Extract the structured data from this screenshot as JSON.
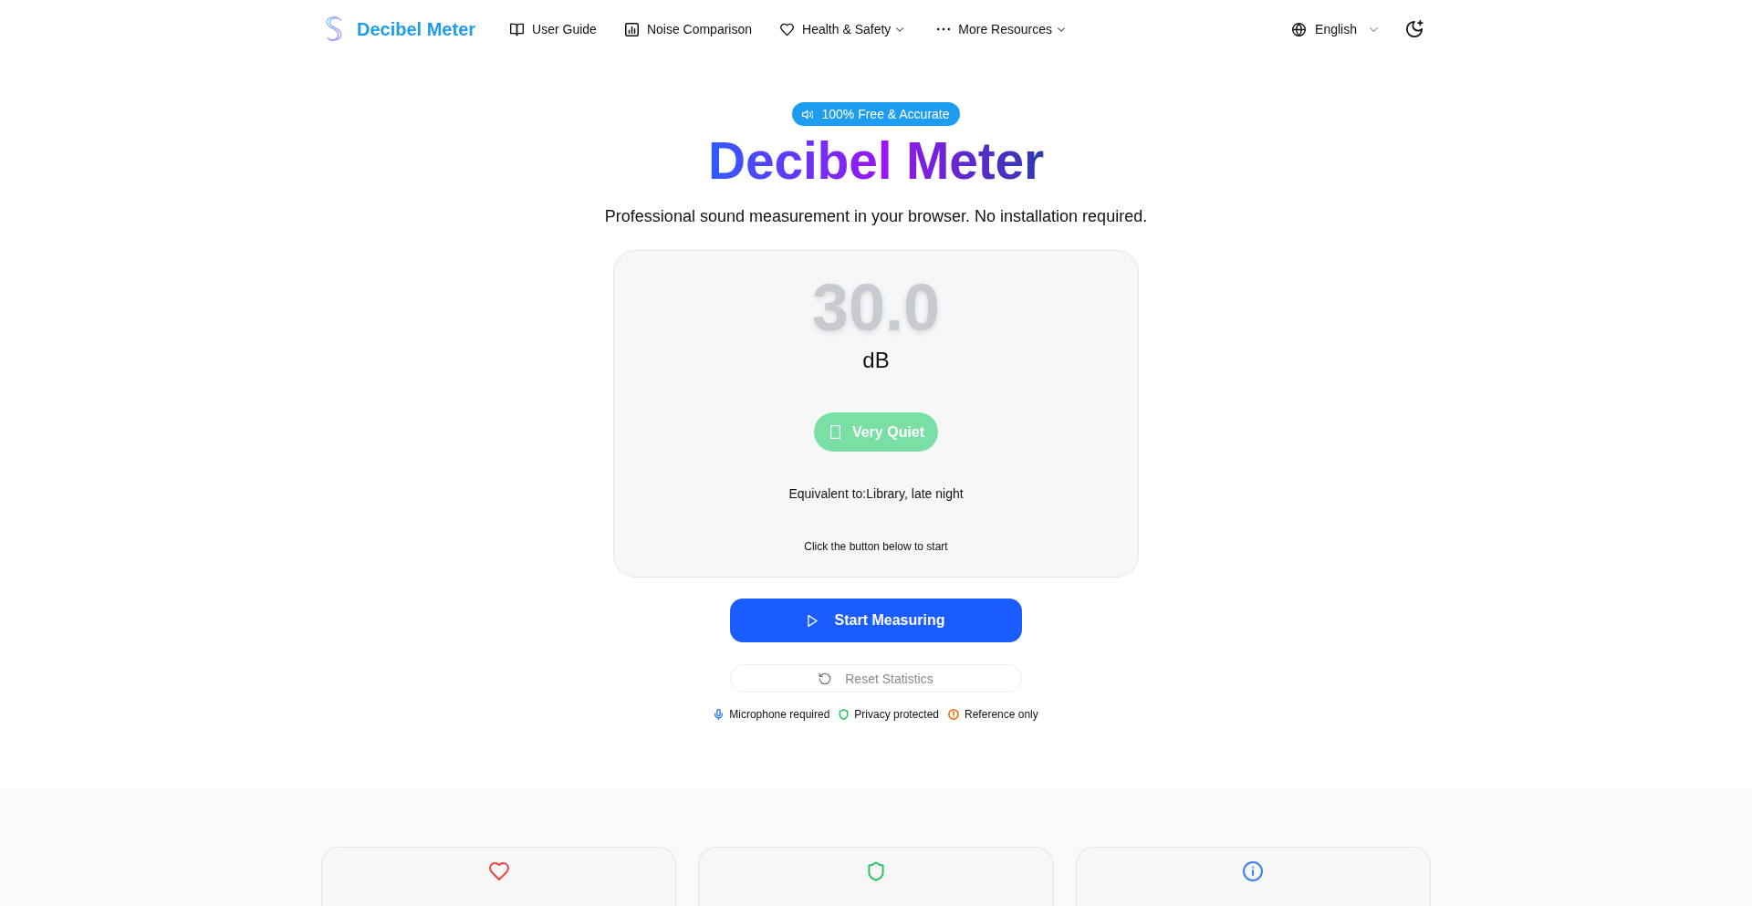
{
  "header": {
    "logo": {
      "text": "Decibel Meter"
    },
    "nav": [
      {
        "label": "User Guide",
        "kind": "book",
        "has_menu": false
      },
      {
        "label": "Noise Comparison",
        "kind": "chart",
        "has_menu": false
      },
      {
        "label": "Health & Safety",
        "kind": "heart",
        "has_menu": true
      },
      {
        "label": "More Resources",
        "kind": "dots",
        "has_menu": true
      }
    ],
    "language": {
      "label": "English"
    }
  },
  "hero": {
    "badge": "100% Free & Accurate",
    "title": "Decibel Meter",
    "subtitle": "Professional sound measurement in your browser. No installation required."
  },
  "meter": {
    "value": "30.0",
    "unit": "dB",
    "level_label": "Very Quiet",
    "equivalent": "Equivalent to:Library, late night",
    "hint": "Click the button below to start"
  },
  "actions": [
    {
      "label": "Start Measuring",
      "kind": "start",
      "disabled": false
    },
    {
      "label": "Reset Statistics",
      "kind": "reset",
      "disabled": true
    }
  ],
  "notes": [
    {
      "kind": "mic",
      "text": "Microphone required",
      "color": "#3b82f6"
    },
    {
      "kind": "shield",
      "text": "Privacy protected",
      "color": "#22c55e"
    },
    {
      "kind": "alert",
      "text": "Reference only",
      "color": "#f97316"
    }
  ],
  "feature_cards": [
    {
      "kind": "heart",
      "color": "#ef4444"
    },
    {
      "kind": "shield",
      "color": "#22c55e"
    },
    {
      "kind": "info",
      "color": "#3b82f6"
    }
  ]
}
